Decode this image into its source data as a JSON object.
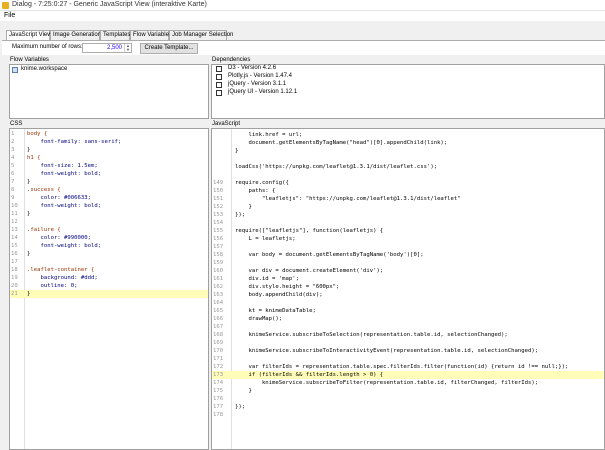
{
  "window": {
    "title": "Dialog - 7:25:0:27 - Generic JavaScript View (interaktive Karte)"
  },
  "menu": {
    "file": "File"
  },
  "tabs": [
    {
      "label": "JavaScript View",
      "active": true
    },
    {
      "label": "Image Generation"
    },
    {
      "label": "Templates"
    },
    {
      "label": "Flow Variables"
    },
    {
      "label": "Job Manager Selection"
    }
  ],
  "toolbar": {
    "max_rows_label": "Maximum number of rows:",
    "max_rows_value": "2,500",
    "create_template": "Create Template..."
  },
  "flow_variables": {
    "title": "Flow Variables",
    "items": [
      "knime.workspace"
    ]
  },
  "dependencies": {
    "title": "Dependencies",
    "items": [
      "D3 - Version 4.2.6",
      "Plotly.js - Version 1.47.4",
      "jQuery - Version 3.1.1",
      "jQuery UI - Version 1.12.1"
    ]
  },
  "css": {
    "title": "CSS",
    "lines": [
      {
        "n": "1",
        "text": "body {"
      },
      {
        "n": "2",
        "text": "    font-family: sans-serif;"
      },
      {
        "n": "3",
        "text": "}"
      },
      {
        "n": "4",
        "text": "h1 {"
      },
      {
        "n": "5",
        "text": "    font-size: 1.5em;"
      },
      {
        "n": "6",
        "text": "    font-weight: bold;"
      },
      {
        "n": "7",
        "text": "}"
      },
      {
        "n": "8",
        "text": ".success {"
      },
      {
        "n": "9",
        "text": "    color: #006633;"
      },
      {
        "n": "10",
        "text": "    font-weight: bold;"
      },
      {
        "n": "11",
        "text": "}"
      },
      {
        "n": "12",
        "text": ""
      },
      {
        "n": "13",
        "text": ".failure {"
      },
      {
        "n": "14",
        "text": "    color: #990000;"
      },
      {
        "n": "15",
        "text": "    font-weight: bold;"
      },
      {
        "n": "16",
        "text": "}"
      },
      {
        "n": "17",
        "text": ""
      },
      {
        "n": "18",
        "text": ".leaflet-container {"
      },
      {
        "n": "19",
        "text": "    background: #ddd;"
      },
      {
        "n": "20",
        "text": "    outline: 0;"
      },
      {
        "n": "21",
        "text": "}"
      }
    ]
  },
  "javascript": {
    "title": "JavaScript",
    "lines": [
      {
        "n": "",
        "text": "    link.href = url;"
      },
      {
        "n": "",
        "text": "    document.getElementsByTagName(\"head\")[0].appendChild(link);"
      },
      {
        "n": "",
        "text": "}"
      },
      {
        "n": "",
        "text": ""
      },
      {
        "n": "",
        "text": "loadCss('https://unpkg.com/leaflet@1.3.1/dist/leaflet.css');"
      },
      {
        "n": "",
        "text": ""
      },
      {
        "n": "149",
        "text": "require.config({"
      },
      {
        "n": "150",
        "text": "    paths: {"
      },
      {
        "n": "151",
        "text": "        \"leafletjs\": \"https://unpkg.com/leaflet@1.3.1/dist/leaflet\""
      },
      {
        "n": "152",
        "text": "    }"
      },
      {
        "n": "153",
        "text": "});"
      },
      {
        "n": "154",
        "text": ""
      },
      {
        "n": "155",
        "text": "require([\"leafletjs\"], function(leafletjs) {"
      },
      {
        "n": "156",
        "text": "    L = leafletjs;"
      },
      {
        "n": "157",
        "text": ""
      },
      {
        "n": "158",
        "text": "    var body = document.getElementsByTagName('body')[0];"
      },
      {
        "n": "159",
        "text": ""
      },
      {
        "n": "160",
        "text": "    var div = document.createElement('div');"
      },
      {
        "n": "161",
        "text": "    div.id = 'map';"
      },
      {
        "n": "162",
        "text": "    div.style.height = \"600px\";"
      },
      {
        "n": "163",
        "text": "    body.appendChild(div);"
      },
      {
        "n": "164",
        "text": ""
      },
      {
        "n": "165",
        "text": "    kt = knimeDataTable;"
      },
      {
        "n": "166",
        "text": "    drawMap();"
      },
      {
        "n": "167",
        "text": ""
      },
      {
        "n": "168",
        "text": "    knimeService.subscribeToSelection(representation.table.id, selectionChanged);"
      },
      {
        "n": "169",
        "text": ""
      },
      {
        "n": "170",
        "text": "    knimeService.subscribeToInteractivityEvent(representation.table.id, selectionChanged);"
      },
      {
        "n": "171",
        "text": ""
      },
      {
        "n": "172",
        "text": "    var filterIds = representation.table.spec.filterIds.filter(function(id) {return id !== null;});"
      },
      {
        "n": "173",
        "text": "    if (filterIds && filterIds.length > 0) {"
      },
      {
        "n": "174",
        "text": "        knimeService.subscribeToFilter(representation.table.id, filterChanged, filterIds);"
      },
      {
        "n": "175",
        "text": "    }"
      },
      {
        "n": "176",
        "text": ""
      },
      {
        "n": "177",
        "text": "});"
      },
      {
        "n": "178",
        "text": ""
      }
    ]
  }
}
